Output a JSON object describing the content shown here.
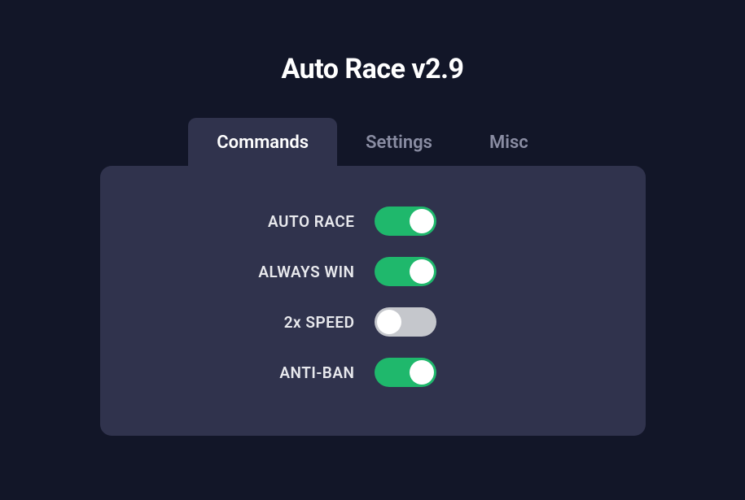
{
  "header": {
    "title": "Auto Race v2.9"
  },
  "tabs": [
    {
      "label": "Commands",
      "active": true
    },
    {
      "label": "Settings",
      "active": false
    },
    {
      "label": "Misc",
      "active": false
    }
  ],
  "options": [
    {
      "label": "AUTO RACE",
      "enabled": true
    },
    {
      "label": "ALWAYS WIN",
      "enabled": true
    },
    {
      "label": "2x SPEED",
      "enabled": false
    },
    {
      "label": "ANTI-BAN",
      "enabled": true
    }
  ],
  "colors": {
    "bg": "#121628",
    "panel": "#30334d",
    "toggle_on": "#1fb86c",
    "toggle_off": "#c5c7cc"
  }
}
